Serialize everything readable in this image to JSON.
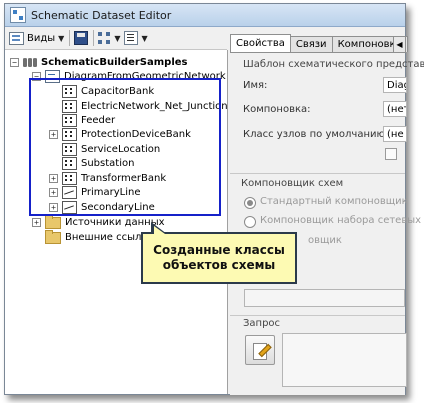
{
  "window": {
    "title": "Schematic Dataset Editor"
  },
  "toolbar": {
    "views_label": "Виды"
  },
  "tree": {
    "root": "SchematicBuilderSamples",
    "diagram_template": "DiagramFromGeometricNetwork",
    "classes": [
      "CapacitorBank",
      "ElectricNetwork_Net_Junctions",
      "Feeder",
      "ProtectionDeviceBank",
      "ServiceLocation",
      "Substation",
      "TransformerBank",
      "PrimaryLine",
      "SecondaryLine"
    ],
    "folders": [
      "Источники данных",
      "Внешние ссылки"
    ]
  },
  "callout": {
    "line1": "Созданные классы",
    "line2": "объектов схемы"
  },
  "tabs": [
    "Свойства",
    "Связи",
    "Компоновки"
  ],
  "properties": {
    "template_group": "Шаблон схематического представ",
    "name_label": "Имя:",
    "name_value": "Diagra",
    "layout_label": "Компоновка:",
    "layout_value": "(нет",
    "default_node_class_label": "Класс узлов по умолчанию:",
    "default_node_class_value": "(не",
    "builder_group": "Компоновщик схем",
    "standard_builder": "Стандартный компоновщик",
    "network_builder": "Компоновщик набора сетевых да",
    "third_builder_partial": "овщик",
    "query_group": "Запрос"
  }
}
